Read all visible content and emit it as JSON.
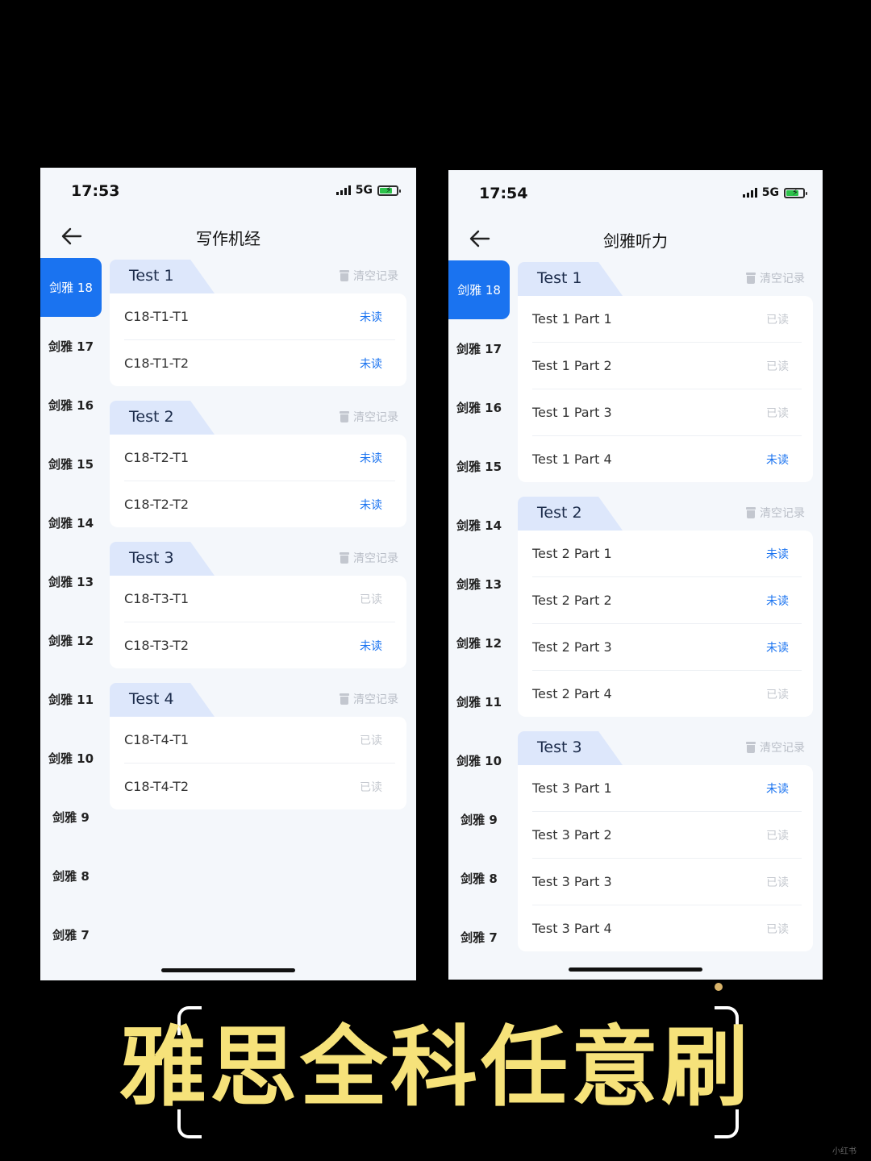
{
  "left_phone": {
    "time": "17:53",
    "network": "5G",
    "title": "写作机经",
    "sidebar": [
      "剑雅 18",
      "剑雅 17",
      "剑雅 16",
      "剑雅 15",
      "剑雅 14",
      "剑雅 13",
      "剑雅 12",
      "剑雅 11",
      "剑雅 10",
      "剑雅 9",
      "剑雅 8",
      "剑雅 7"
    ],
    "active_index": 0,
    "clear_label": "清空记录",
    "sections": [
      {
        "name": "Test 1",
        "rows": [
          {
            "label": "C18-T1-T1",
            "status": "未读",
            "read": false
          },
          {
            "label": "C18-T1-T2",
            "status": "未读",
            "read": false
          }
        ]
      },
      {
        "name": "Test 2",
        "rows": [
          {
            "label": "C18-T2-T1",
            "status": "未读",
            "read": false
          },
          {
            "label": "C18-T2-T2",
            "status": "未读",
            "read": false
          }
        ]
      },
      {
        "name": "Test 3",
        "rows": [
          {
            "label": "C18-T3-T1",
            "status": "已读",
            "read": true
          },
          {
            "label": "C18-T3-T2",
            "status": "未读",
            "read": false
          }
        ]
      },
      {
        "name": "Test 4",
        "rows": [
          {
            "label": "C18-T4-T1",
            "status": "已读",
            "read": true
          },
          {
            "label": "C18-T4-T2",
            "status": "已读",
            "read": true
          }
        ]
      }
    ]
  },
  "right_phone": {
    "time": "17:54",
    "network": "5G",
    "title": "剑雅听力",
    "sidebar": [
      "剑雅 18",
      "剑雅 17",
      "剑雅 16",
      "剑雅 15",
      "剑雅 14",
      "剑雅 13",
      "剑雅 12",
      "剑雅 11",
      "剑雅 10",
      "剑雅 9",
      "剑雅 8",
      "剑雅 7"
    ],
    "active_index": 0,
    "clear_label": "清空记录",
    "sections": [
      {
        "name": "Test 1",
        "rows": [
          {
            "label": "Test 1 Part 1",
            "status": "已读",
            "read": true
          },
          {
            "label": "Test 1 Part 2",
            "status": "已读",
            "read": true
          },
          {
            "label": "Test 1 Part 3",
            "status": "已读",
            "read": true
          },
          {
            "label": "Test 1 Part 4",
            "status": "未读",
            "read": false
          }
        ]
      },
      {
        "name": "Test 2",
        "rows": [
          {
            "label": "Test 2 Part 1",
            "status": "未读",
            "read": false
          },
          {
            "label": "Test 2 Part 2",
            "status": "未读",
            "read": false
          },
          {
            "label": "Test 2 Part 3",
            "status": "未读",
            "read": false
          },
          {
            "label": "Test 2 Part 4",
            "status": "已读",
            "read": true
          }
        ]
      },
      {
        "name": "Test 3",
        "rows": [
          {
            "label": "Test 3 Part 1",
            "status": "未读",
            "read": false
          },
          {
            "label": "Test 3 Part 2",
            "status": "已读",
            "read": true
          },
          {
            "label": "Test 3 Part 3",
            "status": "已读",
            "read": true
          },
          {
            "label": "Test 3 Part 4",
            "status": "已读",
            "read": true
          }
        ]
      }
    ]
  },
  "banner": "雅思全科任意刷",
  "watermark": "小红书",
  "colors": {
    "accent": "#1a73f0",
    "banner": "#f6e27a",
    "tab": "#dde7fb",
    "read": "#c4c8cf"
  }
}
